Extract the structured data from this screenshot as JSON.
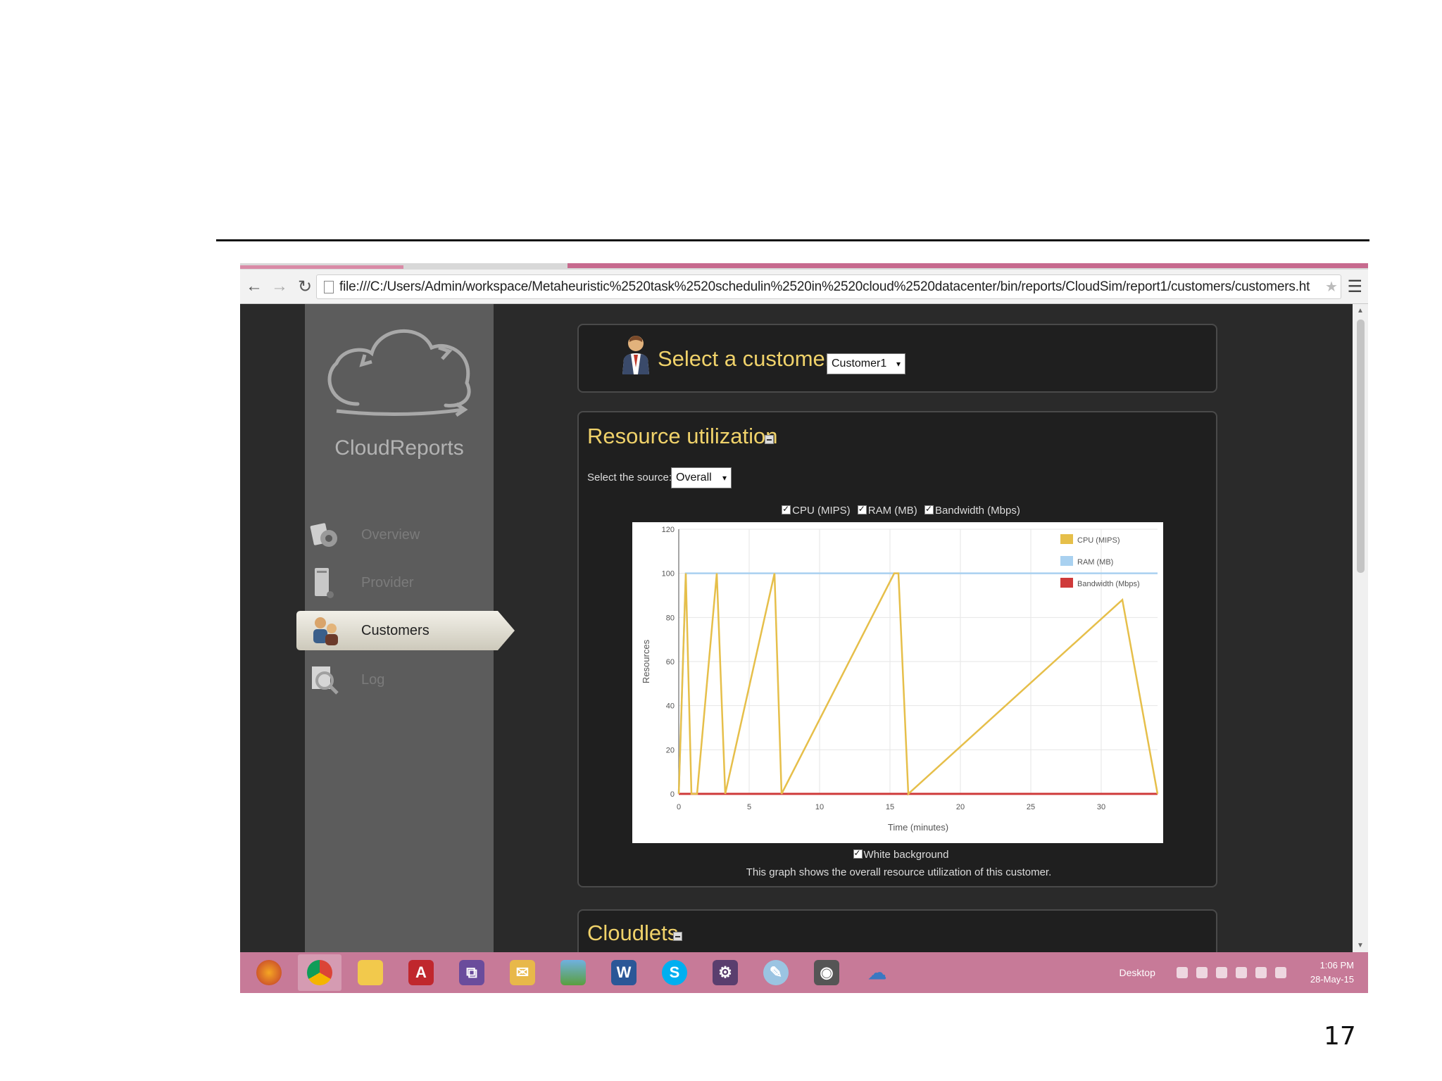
{
  "page_number": "17",
  "browser": {
    "url": "file:///C:/Users/Admin/workspace/Metaheuristic%2520task%2520schedulin%2520in%2520cloud%2520datacenter/bin/reports/CloudSim/report1/customers/customers.ht"
  },
  "sidebar": {
    "brand": "CloudReports",
    "items": [
      {
        "label": "Overview"
      },
      {
        "label": "Provider"
      },
      {
        "label": "Customers"
      },
      {
        "label": "Log"
      }
    ]
  },
  "customer_panel": {
    "title": "Select a customer:",
    "selected": "Customer1"
  },
  "resource_panel": {
    "title": "Resource utilization",
    "source_label": "Select the source:",
    "source_selected": "Overall",
    "checkboxes": [
      "CPU (MIPS)",
      "RAM (MB)",
      "Bandwidth (Mbps)"
    ],
    "white_background_label": "White background",
    "caption": "This graph shows the overall resource utilization of this customer."
  },
  "cloudlets_panel": {
    "title": "Cloudlets"
  },
  "taskbar": {
    "desktop_label": "Desktop",
    "time": "1:06 PM",
    "date": "28-May-15"
  },
  "colors": {
    "cpu": "#e6bf4a",
    "ram": "#a9d1f0",
    "bandwidth": "#cf3a3a",
    "accent_title": "#f0d26a",
    "taskbar": "#c77a98"
  },
  "chart_data": {
    "type": "line",
    "xlabel": "Time (minutes)",
    "ylabel": "Resources",
    "xlim": [
      0,
      34
    ],
    "ylim": [
      0,
      120
    ],
    "x_ticks": [
      0,
      5,
      10,
      15,
      20,
      25,
      30
    ],
    "y_ticks": [
      0,
      20,
      40,
      60,
      80,
      100,
      120
    ],
    "legend_position": "top-right",
    "grid": true,
    "series": [
      {
        "name": "CPU (MIPS)",
        "color": "#e6bf4a",
        "x": [
          0,
          0.5,
          0.9,
          1.3,
          2.7,
          3.3,
          6.8,
          7.3,
          15.3,
          15.6,
          16.3,
          31.5,
          34
        ],
        "y": [
          0,
          100,
          0,
          0,
          100,
          0,
          100,
          0,
          100,
          100,
          0,
          88,
          0
        ]
      },
      {
        "name": "RAM (MB)",
        "color": "#a9d1f0",
        "x": [
          0,
          0.5,
          34
        ],
        "y": [
          0,
          100,
          100
        ]
      },
      {
        "name": "Bandwidth (Mbps)",
        "color": "#cf3a3a",
        "x": [
          0,
          34
        ],
        "y": [
          0,
          0
        ]
      }
    ]
  }
}
